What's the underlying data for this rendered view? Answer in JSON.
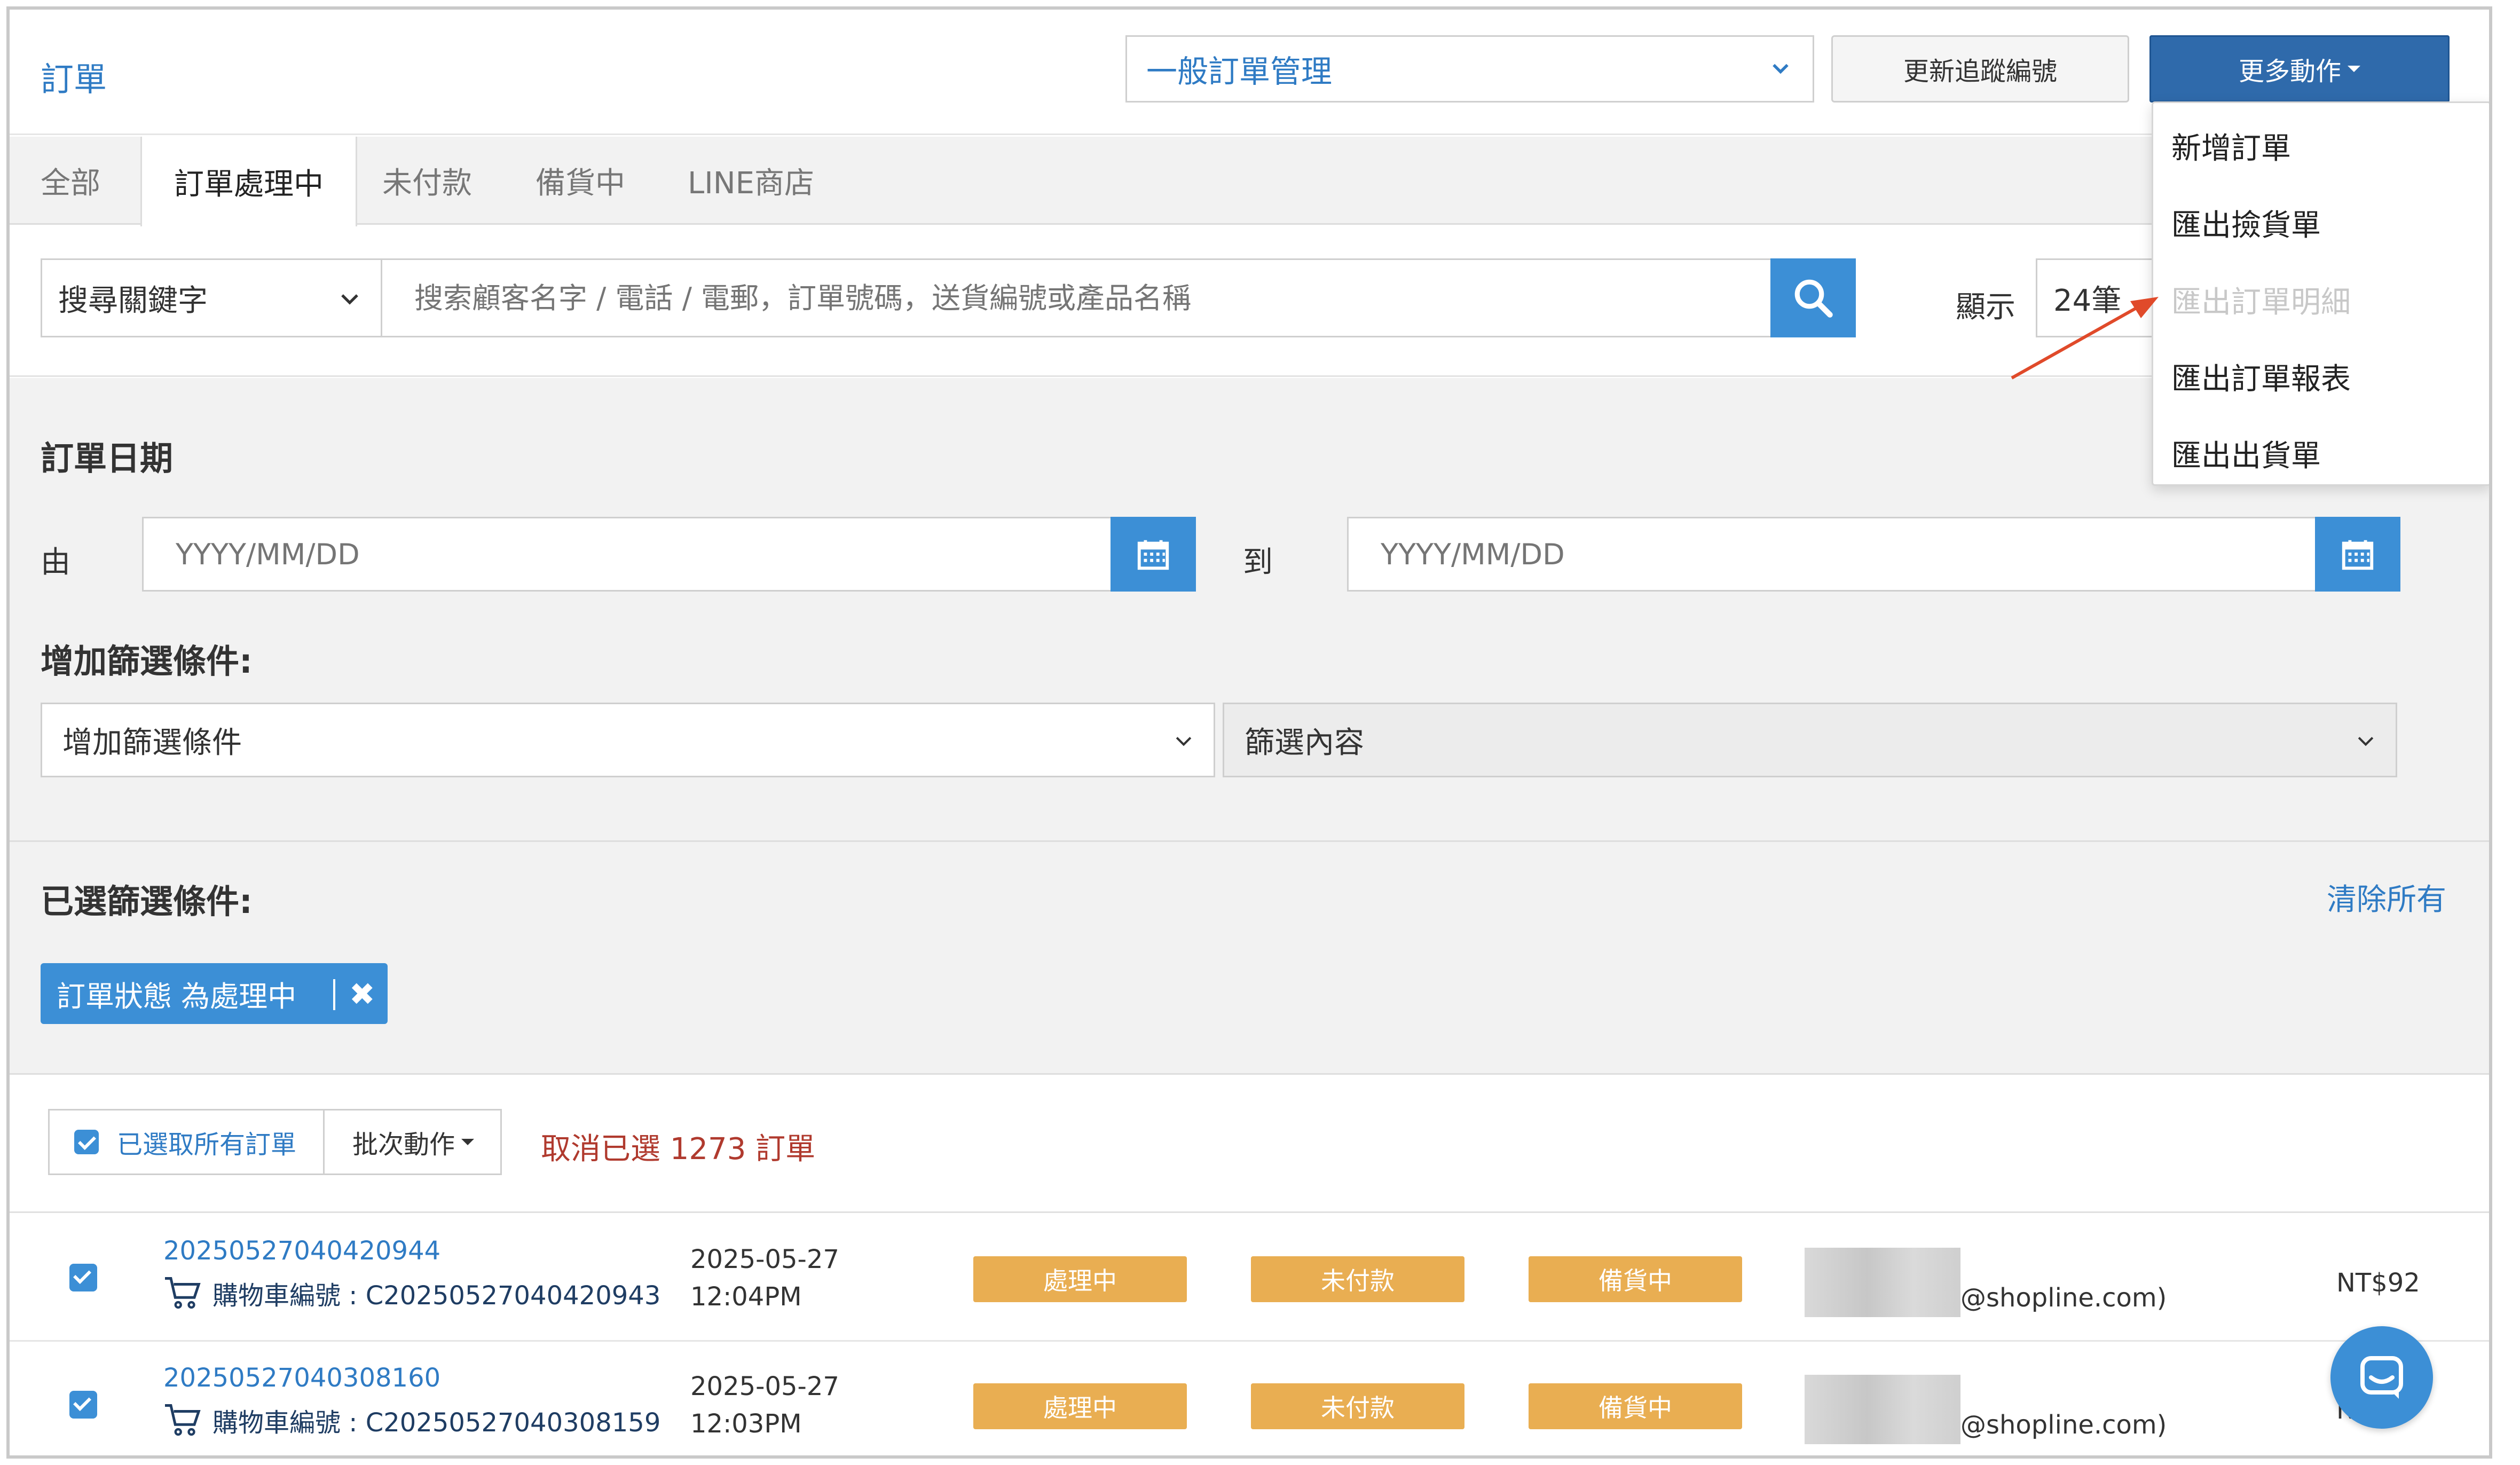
{
  "header": {
    "title": "訂單",
    "order_mgmt_select": "一般訂單管理",
    "update_tracking_button": "更新追蹤編號",
    "more_actions_button": "更多動作"
  },
  "tabs": [
    {
      "label": "全部",
      "active": false
    },
    {
      "label": "訂單處理中",
      "active": true
    },
    {
      "label": "未付款",
      "active": false
    },
    {
      "label": "備貨中",
      "active": false
    },
    {
      "label": "LINE商店",
      "active": false
    }
  ],
  "search": {
    "keyword_select": "搜尋關鍵字",
    "placeholder": "搜索顧客名字 / 電話 / 電郵，訂單號碼，送貨編號或產品名稱",
    "show_label": "顯示",
    "show_value": "24筆"
  },
  "filters": {
    "date_heading": "訂單日期",
    "from_label": "由",
    "to_label": "到",
    "date_placeholder": "YYYY/MM/DD",
    "add_heading": "增加篩選條件:",
    "add_select": "增加篩選條件",
    "content_select": "篩選內容",
    "selected_heading": "已選篩選條件:",
    "clear_all": "清除所有",
    "chip_label": "訂單狀態 為處理中"
  },
  "batch": {
    "select_all_label": "已選取所有訂單",
    "batch_action_label": "批次動作",
    "cancel_selected": "取消已選 1273 訂單"
  },
  "orders": [
    {
      "order_no": "20250527040420944",
      "cart_label": "購物車編號 : C20250527040420943",
      "date": "2025-05-27",
      "time": "12:04PM",
      "status": "處理中",
      "payment": "未付款",
      "delivery": "備貨中",
      "email": "@shopline.com)",
      "amount": "NT$92"
    },
    {
      "order_no": "20250527040308160",
      "cart_label": "購物車編號 : C20250527040308159",
      "date": "2025-05-27",
      "time": "12:03PM",
      "status": "處理中",
      "payment": "未付款",
      "delivery": "備貨中",
      "email": "@shopline.com)",
      "amount": "NT$"
    }
  ],
  "more_menu": [
    {
      "label": "新增訂單",
      "disabled": false
    },
    {
      "label": "匯出撿貨單",
      "disabled": false
    },
    {
      "label": "匯出訂單明細",
      "disabled": true
    },
    {
      "label": "匯出訂單報表",
      "disabled": false
    },
    {
      "label": "匯出出貨單",
      "disabled": false
    }
  ],
  "colors": {
    "primary": "#3c8fd6",
    "dark_primary": "#2f6aab",
    "badge": "#e9ae52",
    "danger_text": "#b03a2e",
    "annotation_arrow": "#e04a2a"
  },
  "icons": [
    "chevron-down-icon",
    "search-icon",
    "calendar-icon",
    "close-icon",
    "checkbox-icon",
    "cart-icon",
    "chat-icon",
    "annotation-arrow-icon"
  ]
}
